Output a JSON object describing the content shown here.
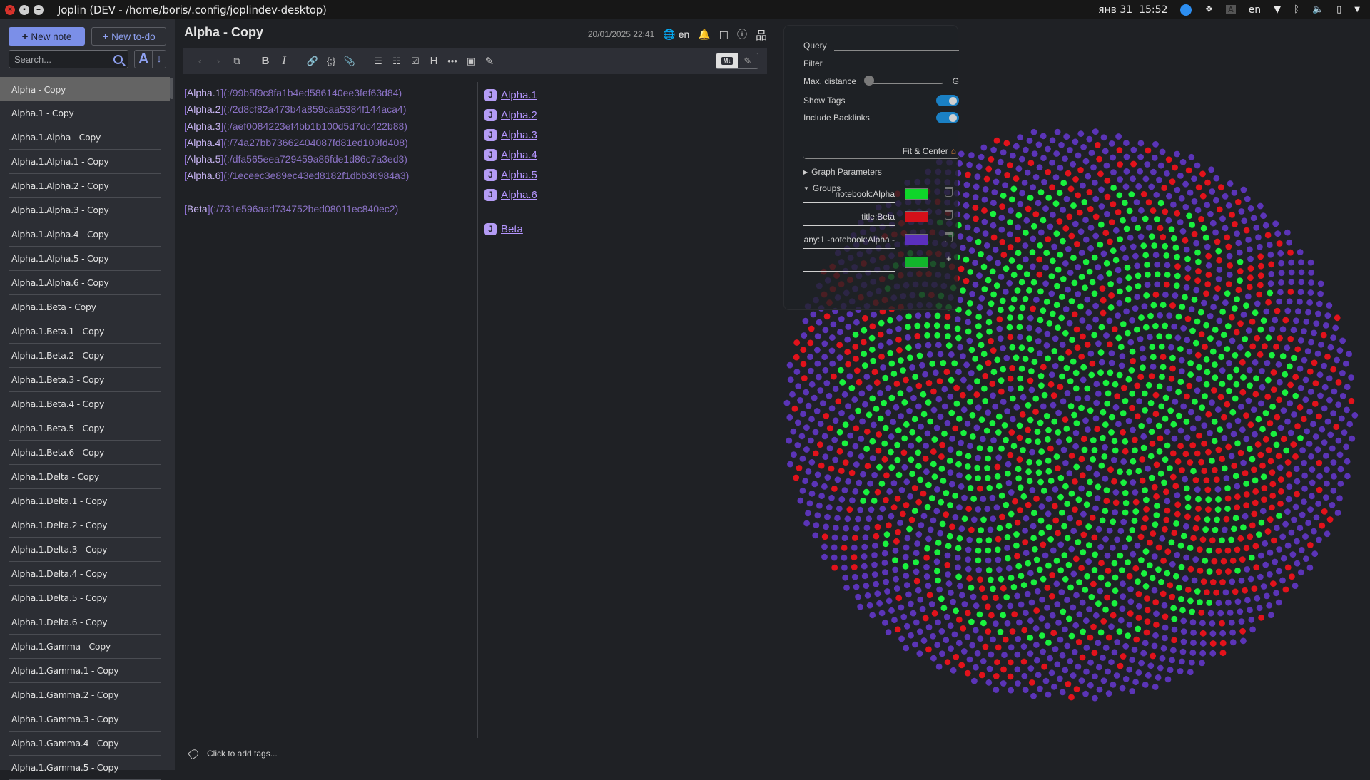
{
  "os": {
    "window_title": "Joplin (DEV - /home/boris/.config/joplindev-desktop)",
    "date": "янв 31",
    "time": "15:52",
    "keyboard_layout": "en",
    "tray_icons": [
      "update-badge-icon",
      "dropbox-icon",
      "input-method-icon",
      "wifi-icon",
      "bluetooth-icon",
      "volume-icon",
      "battery-icon",
      "menu-arrow-icon"
    ]
  },
  "notelist": {
    "new_note_label": "New note",
    "new_todo_label": "New to-do",
    "search_placeholder": "Search...",
    "sort_field_label": "A",
    "sort_dir_label": "↓",
    "items": [
      "Alpha - Copy",
      "Alpha.1 - Copy",
      "Alpha.1.Alpha - Copy",
      "Alpha.1.Alpha.1 - Copy",
      "Alpha.1.Alpha.2 - Copy",
      "Alpha.1.Alpha.3 - Copy",
      "Alpha.1.Alpha.4 - Copy",
      "Alpha.1.Alpha.5 - Copy",
      "Alpha.1.Alpha.6 - Copy",
      "Alpha.1.Beta - Copy",
      "Alpha.1.Beta.1 - Copy",
      "Alpha.1.Beta.2 - Copy",
      "Alpha.1.Beta.3 - Copy",
      "Alpha.1.Beta.4 - Copy",
      "Alpha.1.Beta.5 - Copy",
      "Alpha.1.Beta.6 - Copy",
      "Alpha.1.Delta - Copy",
      "Alpha.1.Delta.1 - Copy",
      "Alpha.1.Delta.2 - Copy",
      "Alpha.1.Delta.3 - Copy",
      "Alpha.1.Delta.4 - Copy",
      "Alpha.1.Delta.5 - Copy",
      "Alpha.1.Delta.6 - Copy",
      "Alpha.1.Gamma - Copy",
      "Alpha.1.Gamma.1 - Copy",
      "Alpha.1.Gamma.2 - Copy",
      "Alpha.1.Gamma.3 - Copy",
      "Alpha.1.Gamma.4 - Copy",
      "Alpha.1.Gamma.5 - Copy"
    ],
    "selected_index": 0
  },
  "editor": {
    "title": "Alpha - Copy",
    "updated": "20/01/2025 22:41",
    "language": "en",
    "toolbar": {
      "md_label": "M↓",
      "buttons": [
        "back",
        "forward",
        "open-external",
        "bold",
        "italic",
        "link",
        "code",
        "attach",
        "bullet-list",
        "numbered-list",
        "checklist",
        "heading",
        "horizontal-rule",
        "insert-datetime",
        "spellcheck"
      ]
    },
    "source_lines": [
      {
        "text": "Alpha.1",
        "url": "(:/99b5f9c8fa1b4ed586140ee3fef63d84)"
      },
      {
        "text": "Alpha.2",
        "url": "(:/2d8cf82a473b4a859caa5384f144aca4)"
      },
      {
        "text": "Alpha.3",
        "url": "(:/aef0084223ef4bb1b100d5d7dc422b88)"
      },
      {
        "text": "Alpha.4",
        "url": "(:/74a27bb73662404087fd81ed109fd408)"
      },
      {
        "text": "Alpha.5",
        "url": "(:/dfa565eea729459a86fde1d86c7a3ed3)"
      },
      {
        "text": "Alpha.6",
        "url": "(:/1eceec3e89ec43ed8182f1dbb36984a3)"
      },
      {
        "text": "Beta",
        "url": "(:/731e596aad734752bed08011ec840ec2)"
      }
    ],
    "preview_links": [
      "Alpha.1",
      "Alpha.2",
      "Alpha.3",
      "Alpha.4",
      "Alpha.5",
      "Alpha.6",
      "Beta"
    ],
    "tags_prompt": "Click to add tags..."
  },
  "graph": {
    "query_label": "Query",
    "query_value": "",
    "filter_label": "Filter",
    "filter_value": "",
    "max_distance_label": "Max. distance",
    "max_distance_suffix": "G",
    "max_distance_value": 0,
    "show_tags_label": "Show Tags",
    "show_tags": true,
    "include_backlinks_label": "Include Backlinks",
    "include_backlinks": true,
    "fit_center_label": "Fit & Center",
    "graph_parameters_label": "Graph Parameters",
    "groups_label": "Groups",
    "groups": [
      {
        "query": "notebook:Alpha",
        "color": "#0fd62a"
      },
      {
        "query": "title:Beta",
        "color": "#d4101a"
      },
      {
        "query": "any:1 -notebook:Alpha -",
        "color": "#5b2fbe"
      },
      {
        "query": "",
        "color": "#12b52c"
      }
    ],
    "node_colors": {
      "alpha": "#19f23e",
      "beta": "#e3121b",
      "other": "#5b34b8"
    }
  }
}
